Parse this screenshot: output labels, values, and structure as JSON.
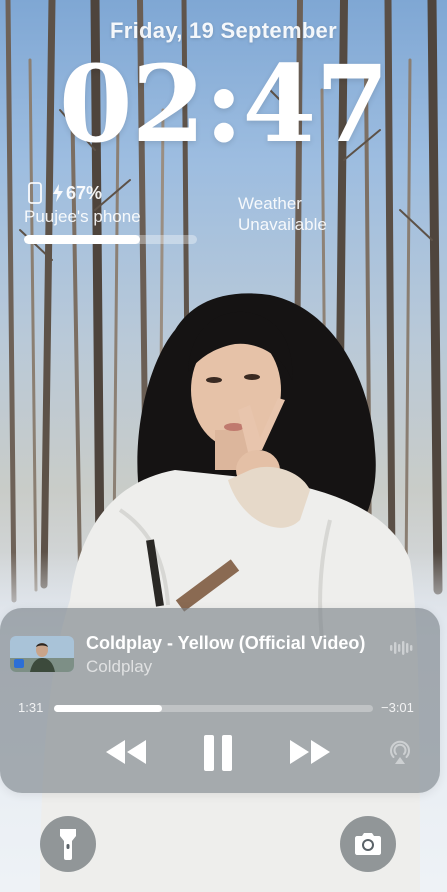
{
  "lockscreen": {
    "date": "Friday, 19 September",
    "time": "02:47"
  },
  "battery_widget": {
    "icon": "phone-icon",
    "charging_icon": "bolt-icon",
    "percent_text": "67%",
    "device_name": "Puujee's phone",
    "level": 0.67
  },
  "weather_widget": {
    "line1": "Weather",
    "line2": "Unavailable"
  },
  "now_playing": {
    "title": "Coldplay - Yellow (Official Video)",
    "artist": "Coldplay",
    "elapsed": "1:31",
    "remaining": "−3:01",
    "progress": 0.34,
    "controls": [
      "rewind-icon",
      "pause-icon",
      "fast-forward-icon",
      "airplay-icon"
    ],
    "waveform_icon": "waveform-icon"
  },
  "quick_actions": {
    "left": "flashlight-icon",
    "right": "camera-icon"
  },
  "colors": {
    "player_bg": "#788086",
    "accent_white": "#ffffff",
    "sky": "#7fa7d4",
    "snow": "#eef2f6"
  }
}
